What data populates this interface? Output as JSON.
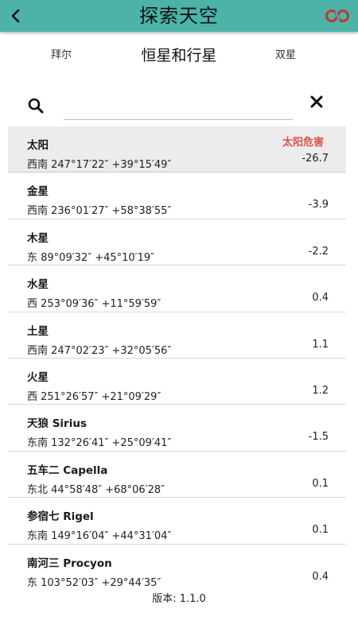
{
  "appbar": {
    "title": "探索天空",
    "back_icon": "chevron-left-icon",
    "link_icon": "chain-link-icon",
    "bar_color": "#4db3a8"
  },
  "tabs": {
    "left": "拜尔",
    "center": "恒星和行星",
    "right": "双星"
  },
  "search": {
    "value": "",
    "placeholder": ""
  },
  "sun_warning": "太阳危害",
  "bodies": [
    {
      "name": "太阳",
      "coords": "西南 247°17′22″ +39°15′49″",
      "mag": "-26.7"
    },
    {
      "name": "金星",
      "coords": "西南 236°01′27″ +58°38′55″",
      "mag": "-3.9"
    },
    {
      "name": "木星",
      "coords": "东 89°09′32″ +45°10′19″",
      "mag": "-2.2"
    },
    {
      "name": "水星",
      "coords": "西 253°09′36″ +11°59′59″",
      "mag": "0.4"
    },
    {
      "name": "土星",
      "coords": "西南 247°02′23″ +32°05′56″",
      "mag": "1.1"
    },
    {
      "name": "火星",
      "coords": "西 251°26′57″ +21°09′29″",
      "mag": "1.2"
    },
    {
      "name": "天狼 Sirius",
      "coords": "东南 132°26′41″ +25°09′41″",
      "mag": "-1.5"
    },
    {
      "name": "五车二 Capella",
      "coords": "东北 44°58′48″ +68°06′28″",
      "mag": "0.1"
    },
    {
      "name": "参宿七 Rigel",
      "coords": "东南 149°16′04″ +44°31′04″",
      "mag": "0.1"
    },
    {
      "name": "南河三 Procyon",
      "coords": "东 103°52′03″ +29°44′35″",
      "mag": "0.4"
    }
  ],
  "footer": {
    "version": "版本: 1.1.0"
  }
}
